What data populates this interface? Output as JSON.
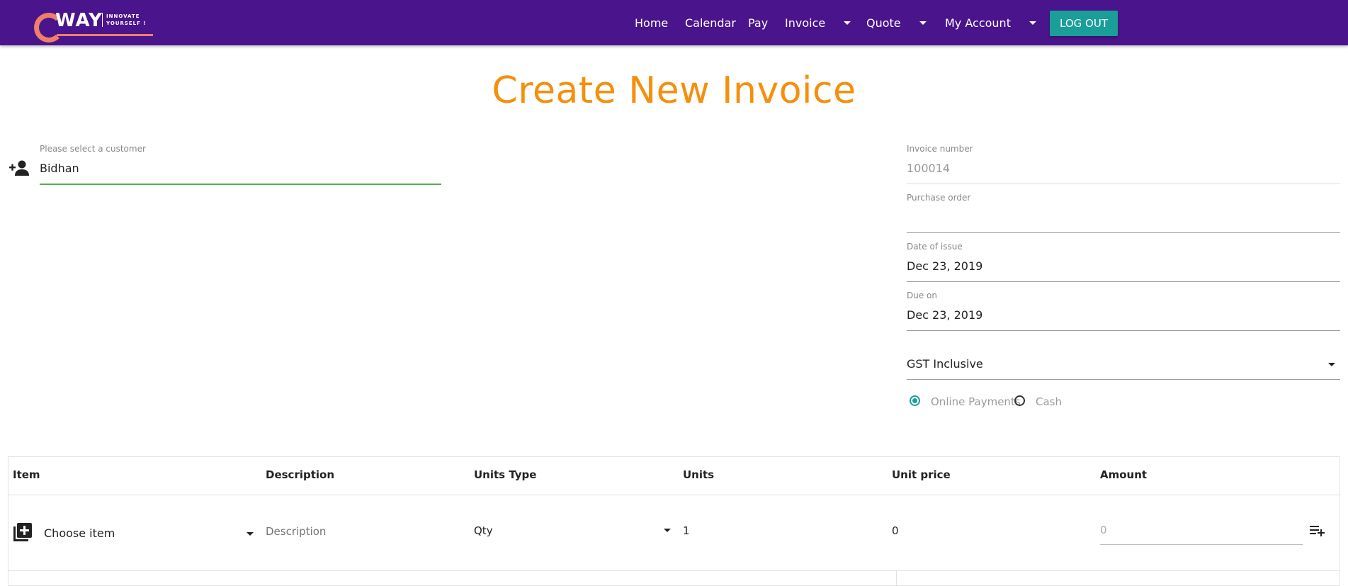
{
  "header": {
    "logo": {
      "brand": "WAY",
      "tagline_1": "INNOVATE",
      "tagline_2": "YOURSELF !"
    },
    "nav": [
      {
        "label": "Home",
        "has_menu": false
      },
      {
        "label": "Calendar",
        "has_menu": false
      },
      {
        "label": "Pay",
        "has_menu": false
      },
      {
        "label": "Invoice",
        "has_menu": true
      },
      {
        "label": "Quote",
        "has_menu": true
      },
      {
        "label": "My Account",
        "has_menu": true
      }
    ],
    "logout_label": "LOG OUT"
  },
  "page": {
    "title": "Create New Invoice"
  },
  "customer": {
    "label": "Please select a customer",
    "value": "Bidhan",
    "icon": "person-add-icon"
  },
  "invoice_details": {
    "invoice_number": {
      "label": "Invoice number",
      "value": "100014"
    },
    "purchase_order": {
      "label": "Purchase order",
      "value": ""
    },
    "date_of_issue": {
      "label": "Date of issue",
      "value": "Dec 23, 2019"
    },
    "due_on": {
      "label": "Due on",
      "value": "Dec 23, 2019"
    },
    "gst": {
      "value": "GST Inclusive"
    },
    "payment_method": {
      "options": [
        "Online Payments",
        "Cash"
      ],
      "selected": "Online Payments"
    }
  },
  "table": {
    "headers": [
      "Item",
      "Description",
      "Units Type",
      "Units",
      "Unit price",
      "Amount"
    ],
    "rows": [
      {
        "item": "Choose item",
        "description_placeholder": "Description",
        "units_type": "Qty",
        "units": "1",
        "unit_price": "0",
        "amount": "0"
      }
    ]
  },
  "colors": {
    "header_bg": "#4a148c",
    "accent_orange": "#f58f0c",
    "teal": "#1a9e9a",
    "active_underline": "#4caf50"
  }
}
